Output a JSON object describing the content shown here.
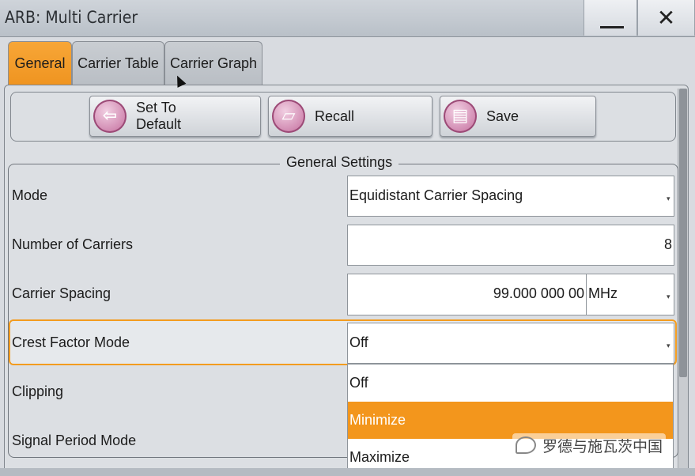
{
  "window": {
    "title": "ARB: Multi Carrier"
  },
  "tabs": [
    {
      "label": "General",
      "active": true
    },
    {
      "label": "Carrier Table",
      "active": false
    },
    {
      "label": "Carrier Graph",
      "active": false
    }
  ],
  "toolbar": {
    "set_default_line1": "Set To",
    "set_default_line2": "Default",
    "recall_label": "Recall",
    "save_label": "Save"
  },
  "general_settings": {
    "title": "General Settings",
    "mode": {
      "label": "Mode",
      "value": "Equidistant Carrier Spacing"
    },
    "num_carriers": {
      "label": "Number of Carriers",
      "value": "8"
    },
    "carrier_spacing": {
      "label": "Carrier Spacing",
      "value": "99.000 000 00",
      "unit": "MHz"
    },
    "crest_factor_mode": {
      "label": "Crest Factor Mode",
      "value": "Off"
    },
    "clipping": {
      "label": "Clipping"
    },
    "signal_period_mode": {
      "label": "Signal Period Mode"
    }
  },
  "crest_dropdown": {
    "options": [
      "Off",
      "Minimize",
      "Maximize"
    ],
    "highlighted": "Minimize"
  },
  "watermark": {
    "text": "罗德与施瓦茨中国"
  },
  "colors": {
    "accent": "#f3961c",
    "panel": "#dcdfe3"
  }
}
